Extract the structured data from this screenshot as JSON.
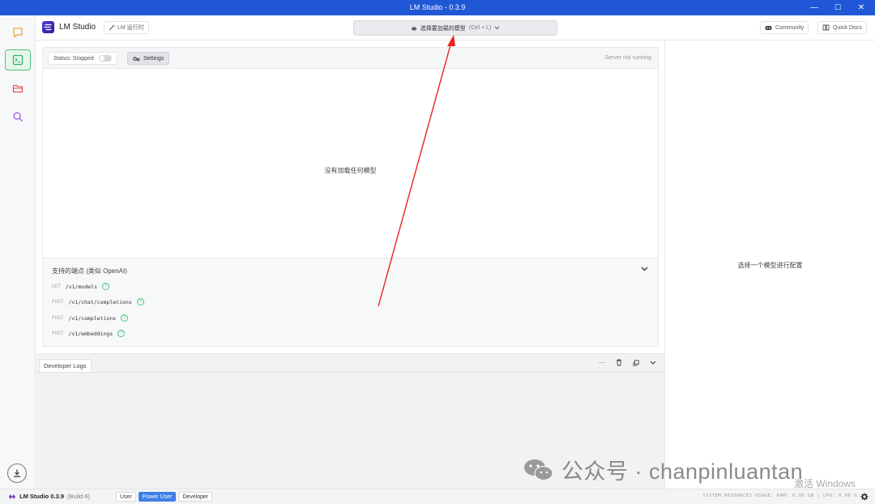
{
  "window": {
    "title": "LM Studio - 0.3.9",
    "minimize": "—",
    "maximize": "☐",
    "close": "✕"
  },
  "header": {
    "app_name": "LM Studio",
    "runtime_label": "LM 运行时",
    "model_select": {
      "label": "选择要加载的模型",
      "shortcut": "(Ctrl + L)"
    },
    "community_label": "Community",
    "docs_label": "Quick Docs"
  },
  "sidebar": {
    "items": [
      {
        "name": "chat",
        "icon": "chat-bubble-icon",
        "color": "#e9a23b"
      },
      {
        "name": "developer",
        "icon": "terminal-icon",
        "color": "#2fb35f",
        "active": true
      },
      {
        "name": "my-models",
        "icon": "folder-icon",
        "color": "#e5545e"
      },
      {
        "name": "discover",
        "icon": "search-icon",
        "color": "#a15be3"
      }
    ],
    "download_icon": "download-icon"
  },
  "server": {
    "status_label": "Status: Stopped",
    "settings_label": "Settings",
    "server_state": "Server not running",
    "empty_message": "没有加载任何模型"
  },
  "endpoints": {
    "title": "支持的端点 (类似 OpenAI)",
    "items": [
      {
        "method": "GET",
        "path": "/v1/models"
      },
      {
        "method": "POST",
        "path": "/v1/chat/completions"
      },
      {
        "method": "POST",
        "path": "/v1/completions"
      },
      {
        "method": "POST",
        "path": "/v1/embeddings"
      }
    ]
  },
  "logs": {
    "tab_label": "Developer Logs",
    "more": "···",
    "delete_icon": "trash-icon",
    "copy_icon": "copy-icon",
    "collapse_icon": "chevron-down-icon"
  },
  "config_panel": {
    "message": "选择一个模型进行配置"
  },
  "bottom_bar": {
    "app_name": "LM Studio 0.3.9",
    "build": "(Build 6)",
    "modes": [
      "User",
      "Power User",
      "Developer"
    ],
    "active_mode": "Power User",
    "system_resources": "SYSTEM RESOURCES USAGE:   RAM: 0.00 GB | CPU: 0.00 %"
  },
  "watermark": {
    "text": "公众号 · chanpinluantan",
    "activation": "激活 Windows"
  },
  "colors": {
    "titlebar": "#1f57d6",
    "accent_green": "#2fb35f",
    "active_mode": "#3d7fe6",
    "annotation_arrow": "#e8251f"
  }
}
